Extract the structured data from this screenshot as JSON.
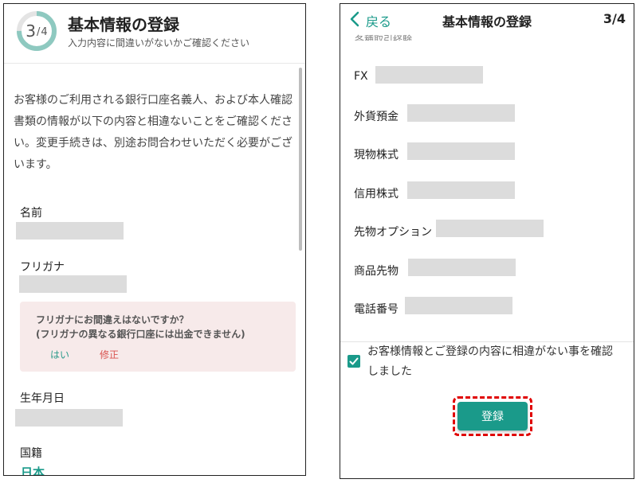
{
  "left": {
    "progress": {
      "current": "3",
      "total": "4",
      "fraction": 0.75
    },
    "header": {
      "title": "基本情報の登録",
      "subtitle": "入力内容に間違いがないかご確認ください"
    },
    "intro": "お客様のご利用される銀行口座名義人、および本人確認書類の情報が以下の内容と相違ないことをご確認ください。変更手続きは、別途お問合わせいただく必要がございます。",
    "fields": {
      "name": "名前",
      "furigana": "フリガナ",
      "birthdate": "生年月日",
      "nationality": "国籍",
      "nationality_value": "日本"
    },
    "warning": {
      "line1": "フリガナにお間違えはないですか？",
      "line2": "(フリガナの異なる銀行口座には出金できません)",
      "yes": "はい",
      "fix": "修正"
    }
  },
  "right": {
    "header": {
      "back": "戻る",
      "title": "基本情報の登録",
      "step": "3/4"
    },
    "partial_label": "各種取引経験",
    "fields": {
      "fx": "FX",
      "foreign_deposit": "外貨預金",
      "spot_stock": "現物株式",
      "margin_stock": "信用株式",
      "futures_options": "先物オプション",
      "commodity_futures": "商品先物",
      "phone": "電話番号"
    },
    "confirm": {
      "checked": true,
      "text": "お客様情報とご登録の内容に相違がない事を確認しました"
    },
    "submit": "登録"
  },
  "colors": {
    "accent": "#1a9a8a",
    "warn_bg": "#f7eaea",
    "error": "#d9534f",
    "highlight": "#e00000",
    "placeholder": "#dcdcdc"
  }
}
